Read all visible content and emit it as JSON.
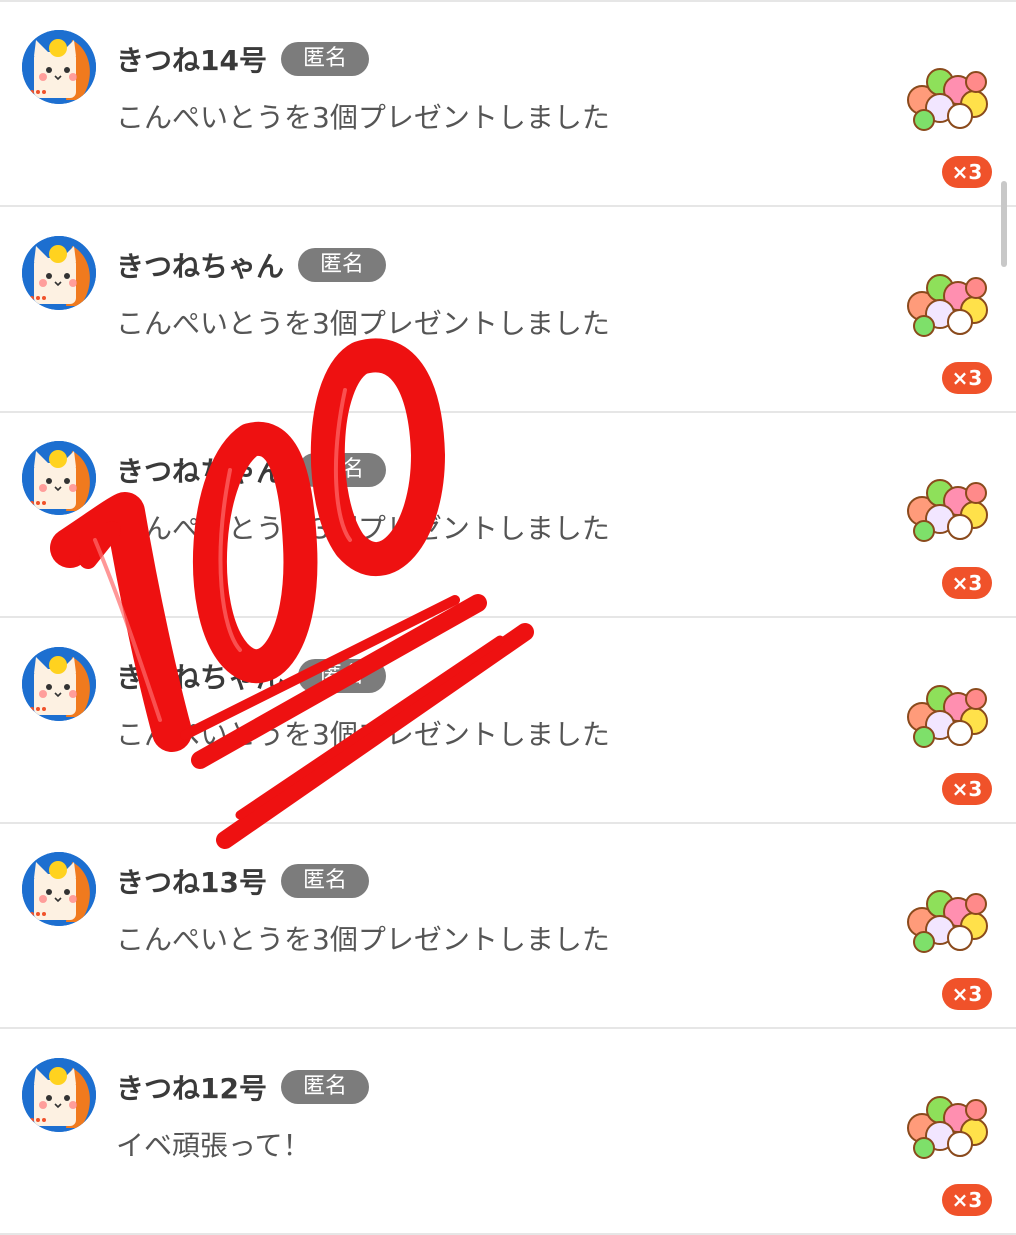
{
  "feed": {
    "items": [
      {
        "name": "きつね14号",
        "badge": "匿名",
        "message": "こんぺいとうを3個プレゼントしました",
        "gift_icon": "konpeito-icon",
        "count": "×3"
      },
      {
        "name": "きつねちゃん",
        "badge": "匿名",
        "message": "こんぺいとうを3個プレゼントしました",
        "gift_icon": "konpeito-icon",
        "count": "×3"
      },
      {
        "name": "きつねちゃん",
        "badge": "匿名",
        "message": "こんぺいとうを3個プレゼントしました",
        "gift_icon": "konpeito-icon",
        "count": "×3"
      },
      {
        "name": "きつねちゃん",
        "badge": "匿名",
        "message": "こんぺいとうを3個プレゼントしました",
        "gift_icon": "konpeito-icon",
        "count": "×3"
      },
      {
        "name": "きつね13号",
        "badge": "匿名",
        "message": "こんぺいとうを3個プレゼントしました",
        "gift_icon": "konpeito-icon",
        "count": "×3"
      },
      {
        "name": "きつね12号",
        "badge": "匿名",
        "message": "イベ頑張って！",
        "gift_icon": "konpeito-icon",
        "count": "×3"
      }
    ]
  },
  "overlay": {
    "icon": "hundred-points-icon",
    "color": "#ee1111"
  },
  "colors": {
    "accent": "#f0522a",
    "badge_bg": "#7c7c7c",
    "avatar_bg": "#1d6fd0"
  }
}
